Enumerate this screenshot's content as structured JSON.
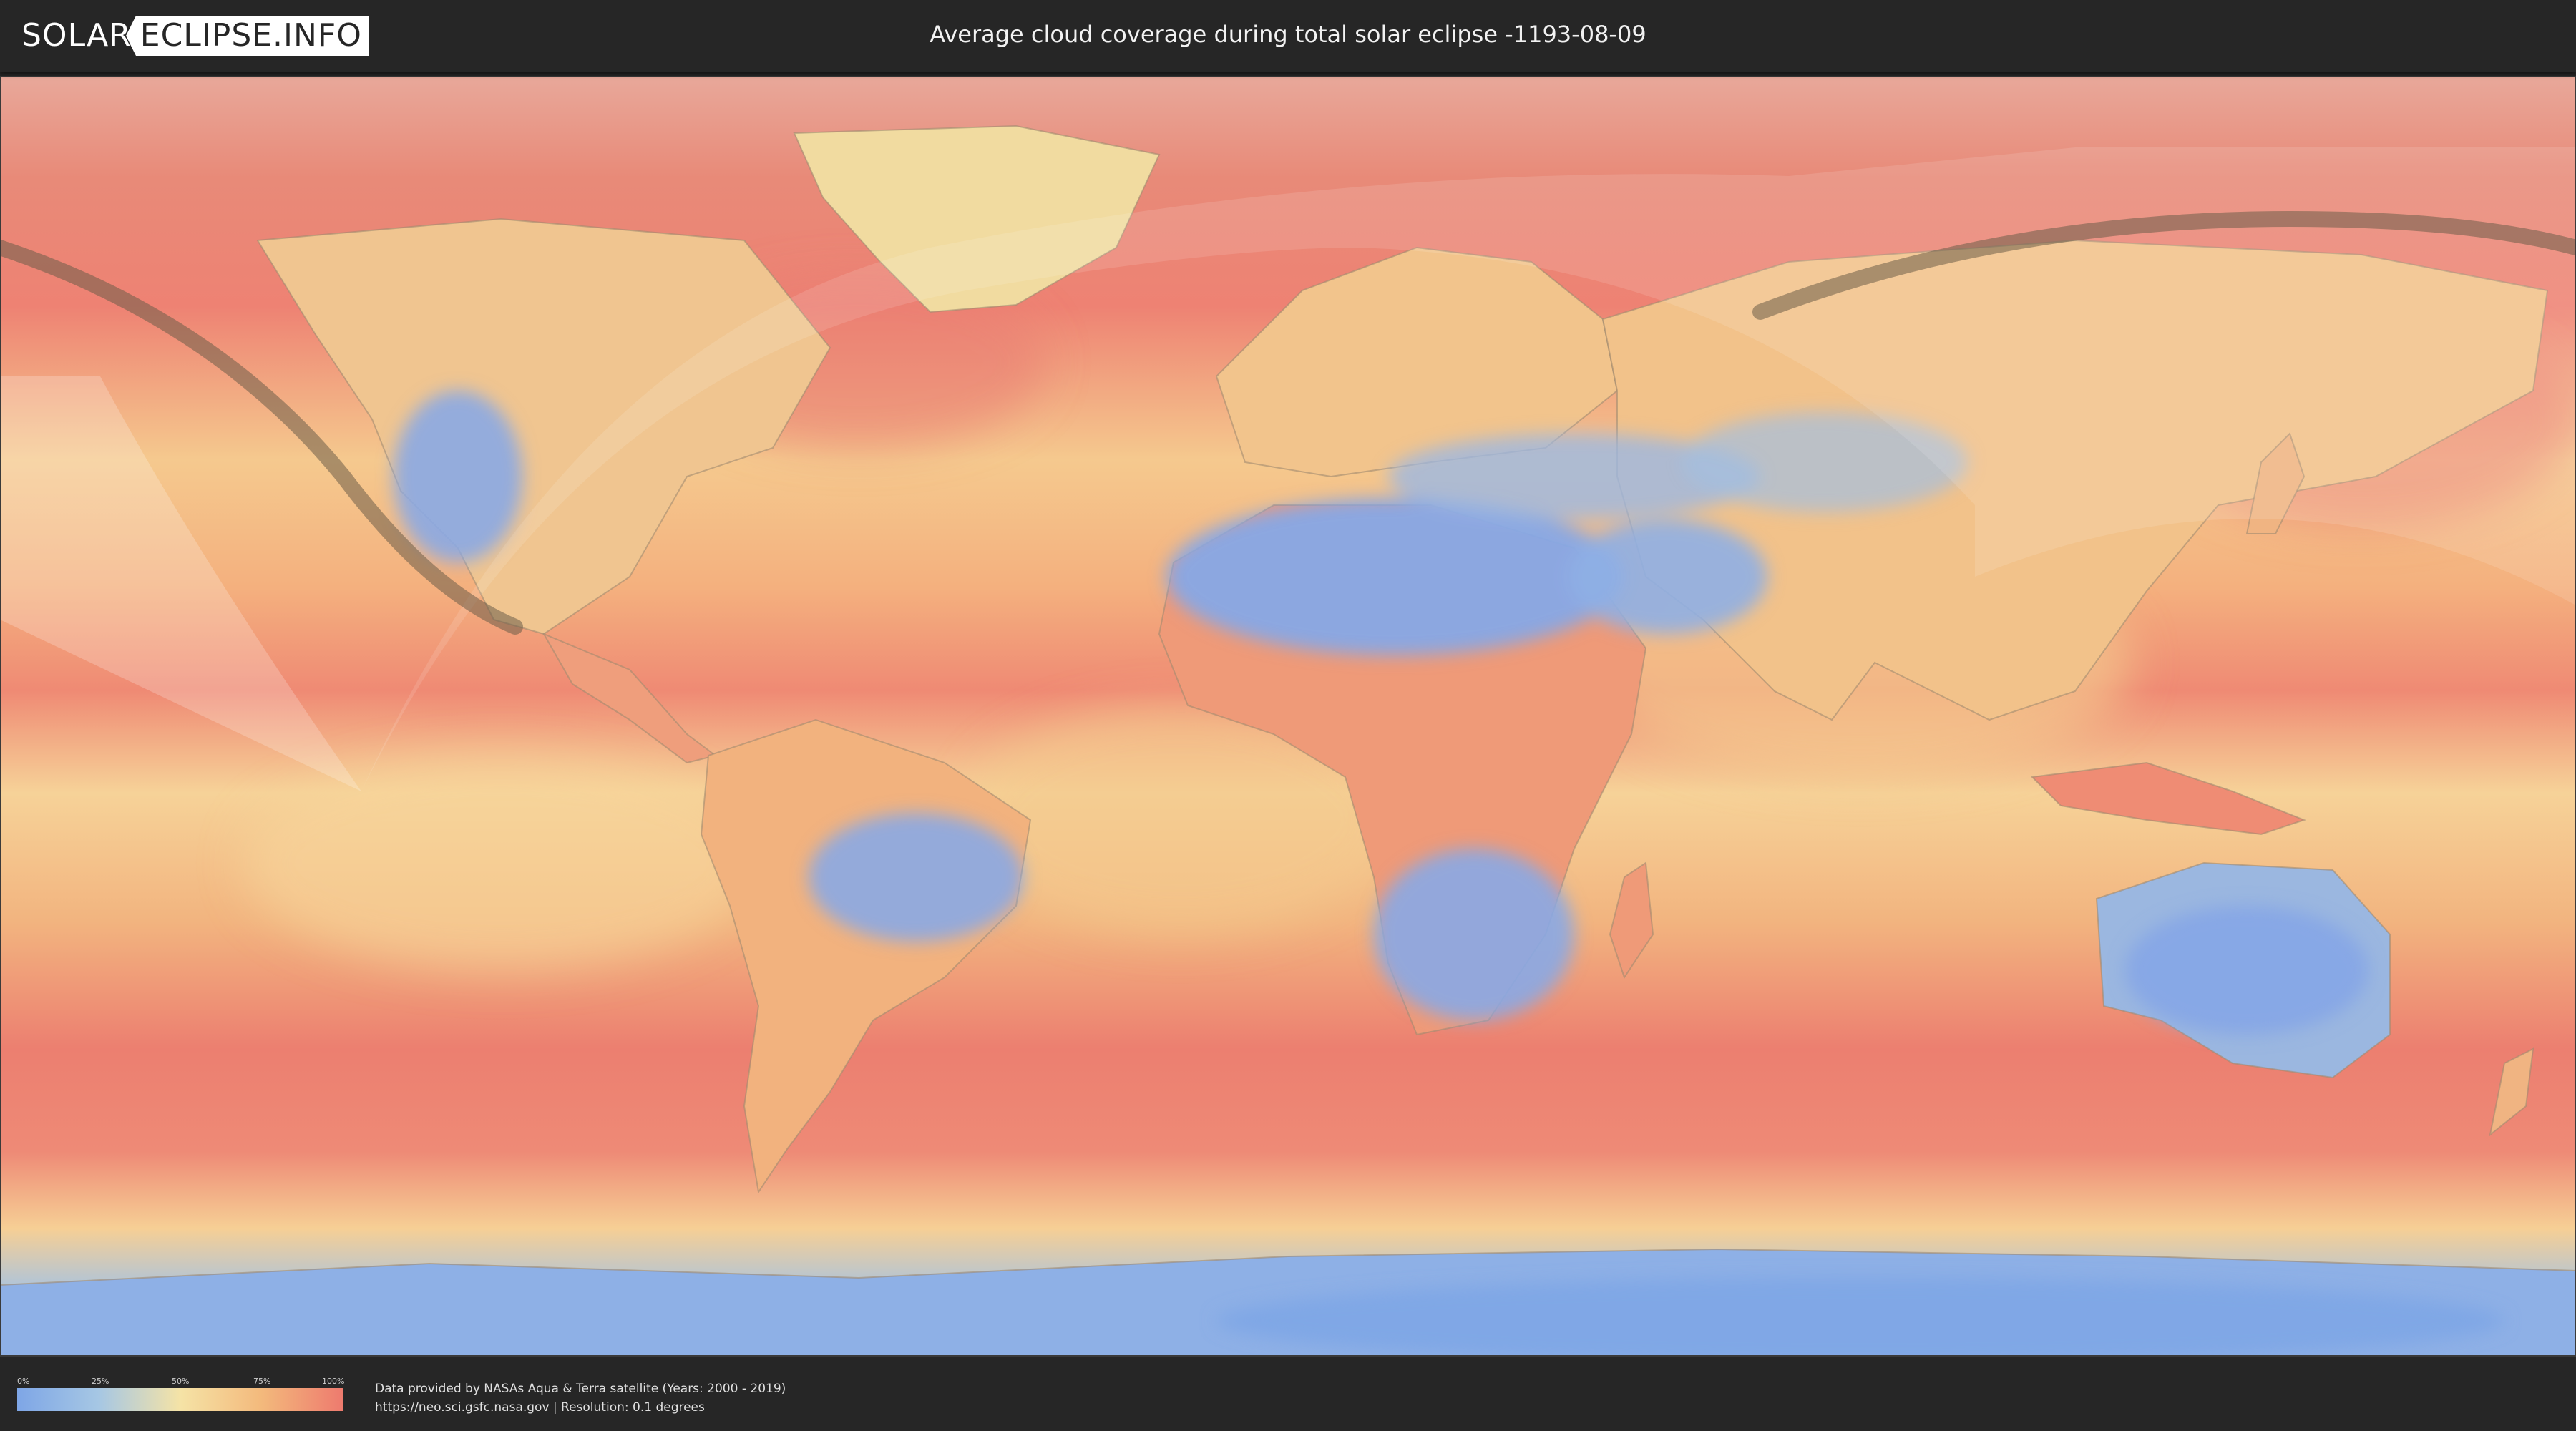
{
  "header": {
    "logo_left": "SOLAR",
    "logo_right": "ECLIPSE.INFO",
    "title": "Average cloud coverage during total solar eclipse -1193-08-09"
  },
  "legend": {
    "ticks": [
      "0%",
      "25%",
      "50%",
      "75%",
      "100%"
    ],
    "colors": [
      "#7ea6e6",
      "#a6c7e4",
      "#f5e3a6",
      "#f3b97c",
      "#ee7a6e"
    ]
  },
  "credits": {
    "line1": "Data provided by NASAs Aqua & Terra satellite (Years: 2000 - 2019)",
    "line2": "https://neo.sci.gsfc.nasa.gov | Resolution: 0.1 degrees"
  },
  "colors": {
    "clear": "#7ea6e6",
    "partly": "#f5e3a6",
    "cloudy": "#ee7a6e",
    "eclipse_path": "#6b5d48",
    "visibility_overlay": "#ffffff"
  }
}
